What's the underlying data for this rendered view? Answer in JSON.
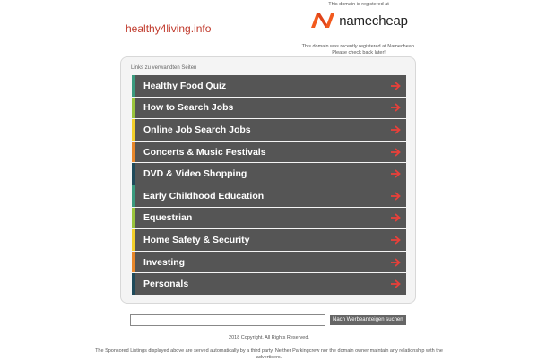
{
  "header": {
    "site_title": "healthy4living.info",
    "registered_text": "This domain is registered at",
    "registrar_name": "namecheap",
    "registrar_note_line1": "This domain was recently registered at Namecheap.",
    "registrar_note_line2": "Please check back later!"
  },
  "panel": {
    "label": "Links zu verwandten Seiten",
    "links": [
      {
        "label": "Healthy Food Quiz",
        "stripe_color": "#3a9a7e"
      },
      {
        "label": "How to Search Jobs",
        "stripe_color": "#9ac43c"
      },
      {
        "label": "Online Job Search Jobs",
        "stripe_color": "#f2cf2a"
      },
      {
        "label": "Concerts & Music Festivals",
        "stripe_color": "#e8872a"
      },
      {
        "label": "DVD & Video Shopping",
        "stripe_color": "#1f4a5a"
      },
      {
        "label": "Early Childhood Education",
        "stripe_color": "#3a9a7e"
      },
      {
        "label": "Equestrian",
        "stripe_color": "#9ac43c"
      },
      {
        "label": "Home Safety & Security",
        "stripe_color": "#f2cf2a"
      },
      {
        "label": "Investing",
        "stripe_color": "#e8872a"
      },
      {
        "label": "Personals",
        "stripe_color": "#1f4a5a"
      }
    ],
    "arrow_icon": "arrow-right-icon",
    "arrow_color": "#e8403a"
  },
  "search": {
    "value": "",
    "placeholder": "",
    "button_label": "Nach Werbeanzeigen suchen"
  },
  "footer": {
    "copyright": "2018 Copyright.  All Rights Reserved.",
    "disclaimer": "The Sponsored Listings displayed above are served automatically by a third party. Neither Parkingcrew nor the domain owner maintain any relationship with the advertisers."
  },
  "colors": {
    "brand_orange": "#f25a1e",
    "title_red": "#c0392b",
    "row_background": "#555555"
  }
}
